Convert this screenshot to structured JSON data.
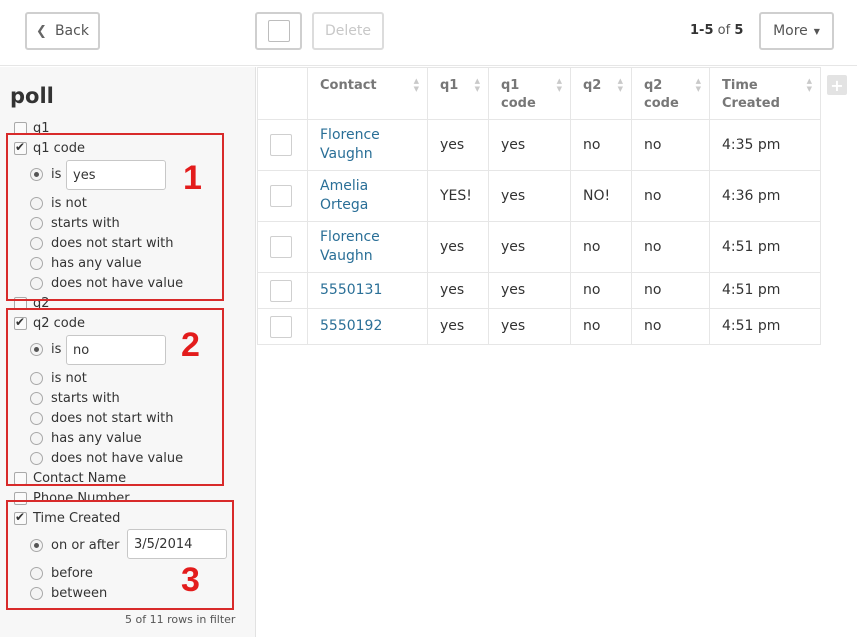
{
  "toolbar": {
    "back_label": "Back",
    "delete_label": "Delete",
    "pager_range": "1-5",
    "pager_of": "of",
    "pager_total": "5",
    "more_label": "More"
  },
  "sidebar": {
    "title": "poll",
    "fields": {
      "q1": "q1",
      "q1_code": "q1 code",
      "q2": "q2",
      "q2_code": "q2 code",
      "contact_name": "Contact Name",
      "phone_number": "Phone Number",
      "time_created": "Time Created"
    },
    "q1_code_filter": {
      "is": "is",
      "is_value": "yes",
      "is_not": "is not",
      "starts_with": "starts with",
      "does_not_start_with": "does not start with",
      "has_any_value": "has any value",
      "does_not_have_value": "does not have value"
    },
    "q2_code_filter": {
      "is": "is",
      "is_value": "no",
      "is_not": "is not",
      "starts_with": "starts with",
      "does_not_start_with": "does not start with",
      "has_any_value": "has any value",
      "does_not_have_value": "does not have value"
    },
    "time_filter": {
      "on_or_after": "on or after",
      "date_value": "3/5/2014",
      "before": "before",
      "between": "between"
    },
    "annotations": [
      "1",
      "2",
      "3"
    ],
    "rows_in_filter": "5 of 11 rows in filter"
  },
  "table": {
    "headers": {
      "contact": "Contact",
      "q1": "q1",
      "q1_code_1": "q1",
      "q1_code_2": "code",
      "q2": "q2",
      "q2_code_1": "q2",
      "q2_code_2": "code",
      "time_1": "Time",
      "time_2": "Created"
    },
    "rows": [
      {
        "contact_1": "Florence",
        "contact_2": "Vaughn",
        "q1": "yes",
        "q1_code": "yes",
        "q2": "no",
        "q2_code": "no",
        "time": "4:35 pm"
      },
      {
        "contact_1": "Amelia",
        "contact_2": "Ortega",
        "q1": "YES!",
        "q1_code": "yes",
        "q2": "NO!",
        "q2_code": "no",
        "time": "4:36 pm"
      },
      {
        "contact_1": "Florence",
        "contact_2": "Vaughn",
        "q1": "yes",
        "q1_code": "yes",
        "q2": "no",
        "q2_code": "no",
        "time": "4:51 pm"
      },
      {
        "contact_1": "5550131",
        "contact_2": "",
        "q1": "yes",
        "q1_code": "yes",
        "q2": "no",
        "q2_code": "no",
        "time": "4:51 pm"
      },
      {
        "contact_1": "5550192",
        "contact_2": "",
        "q1": "yes",
        "q1_code": "yes",
        "q2": "no",
        "q2_code": "no",
        "time": "4:51 pm"
      }
    ]
  },
  "colors": {
    "annotation_red": "#d82a2a",
    "link_blue": "#2a6f97"
  },
  "icons": {
    "back": "chevron-left-icon",
    "more": "caret-down-icon",
    "sort": "sort-icon",
    "add_column": "plus-icon"
  }
}
